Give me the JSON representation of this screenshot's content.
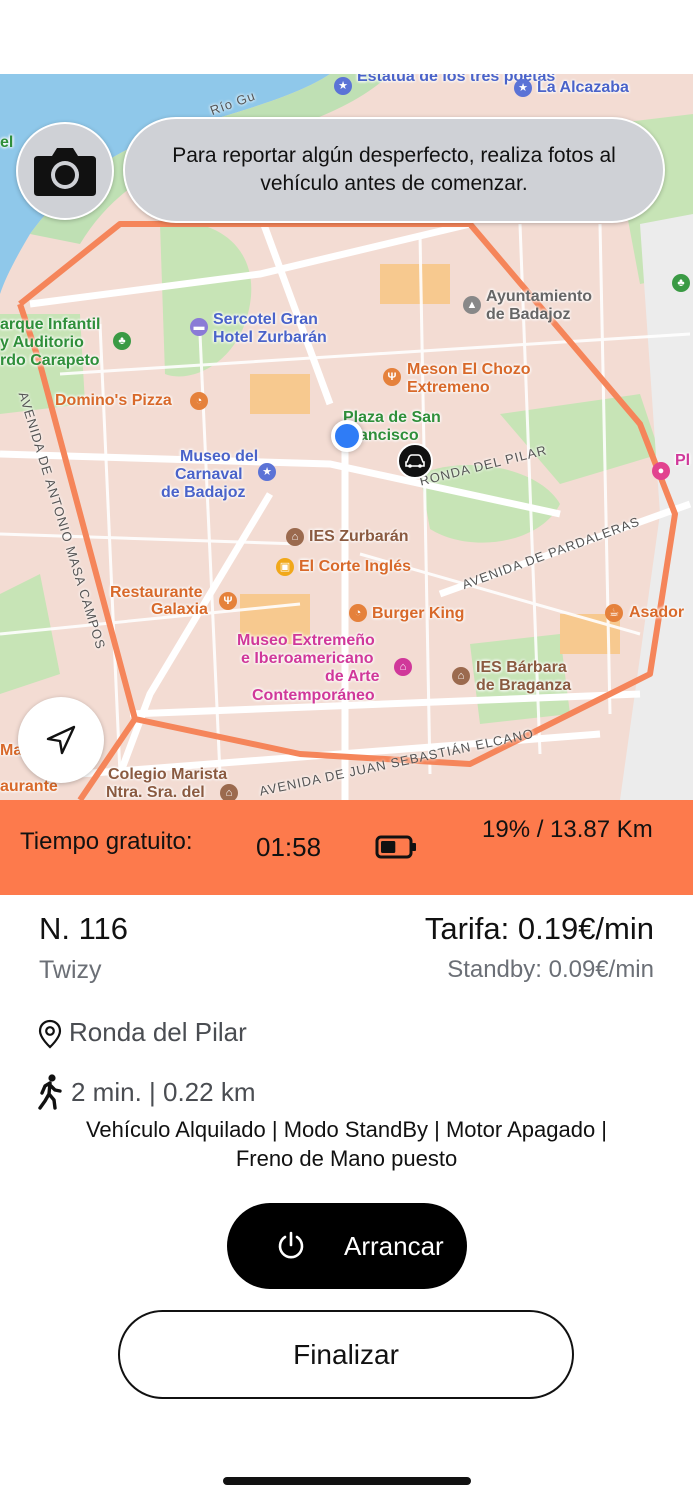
{
  "map": {
    "labels": {
      "estatua": "Estatua de los tres poetas",
      "alcazaba": "La Alcazaba",
      "rio": "Río Gu",
      "el": "el",
      "parque_infantil": "arque Infantil",
      "auditorio": "y Auditorio",
      "carapeto": "rdo Carapeto",
      "sercotel": "Sercotel Gran",
      "hotel_zurbaran": "Hotel Zurbarán",
      "ayuntamiento": "Ayuntamiento",
      "de_badajoz": "de Badajoz",
      "meson": "Meson El Chozo",
      "extremeno": "Extremeno",
      "dominos": "Domino's Pizza",
      "plaza": "Plaza de San",
      "francisco": "Francisco",
      "museo_carnaval_1": "Museo del",
      "museo_carnaval_2": "Carnaval",
      "museo_carnaval_3": "de Badajoz",
      "ies_zurbaran": "IES Zurbarán",
      "corte_ingles": "El Corte Inglés",
      "restaurante": "Restaurante",
      "galaxia": "Galaxia",
      "burger_king": "Burger King",
      "asador": "Asador",
      "museo_ext_1": "Museo Extremeño",
      "museo_ext_2": "e Iberoamericano",
      "museo_ext_3": "de Arte",
      "museo_ext_4": "Contemporáneo",
      "ies_barbara_1": "IES Bárbara",
      "ies_barbara_2": "de Braganza",
      "colegio_1": "Colegio Marista",
      "colegio_2": "Ntra. Sra. del",
      "mar": "Mar",
      "aurante": "aurante",
      "pl": "Pl",
      "ronda_pilar": "RONDA DEL PILAR",
      "av_pardaleras": "AVENIDA DE PARDALERAS",
      "av_antonio": "AVENIDA DE ANTONIO MASA CAMPOS",
      "av_juan": "AVENIDA DE JUAN SEBASTIÁN ELCANO"
    },
    "info_message": "Para reportar algún desperfecto, realiza fotos al vehículo antes de comenzar."
  },
  "status": {
    "free_time_label": "Tiempo gratuito:",
    "free_time_value": "01:58",
    "battery_range": "19% / 13.87 Km",
    "battery_level": 0.19
  },
  "vehicle": {
    "number": "N. 116",
    "model": "Twizy",
    "rate": "Tarifa: 0.19€/min",
    "standby_rate": "Standby: 0.09€/min",
    "location": "Ronda del Pilar",
    "walk": "2 min. | 0.22 km",
    "state_line_1": "Vehículo Alquilado | Modo StandBy | Motor Apagado |",
    "state_line_2": "Freno de Mano puesto"
  },
  "actions": {
    "start_label": "Arrancar",
    "finish_label": "Finalizar"
  },
  "colors": {
    "accent": "#fd7a4c",
    "user_dot": "#2f7cf6"
  }
}
